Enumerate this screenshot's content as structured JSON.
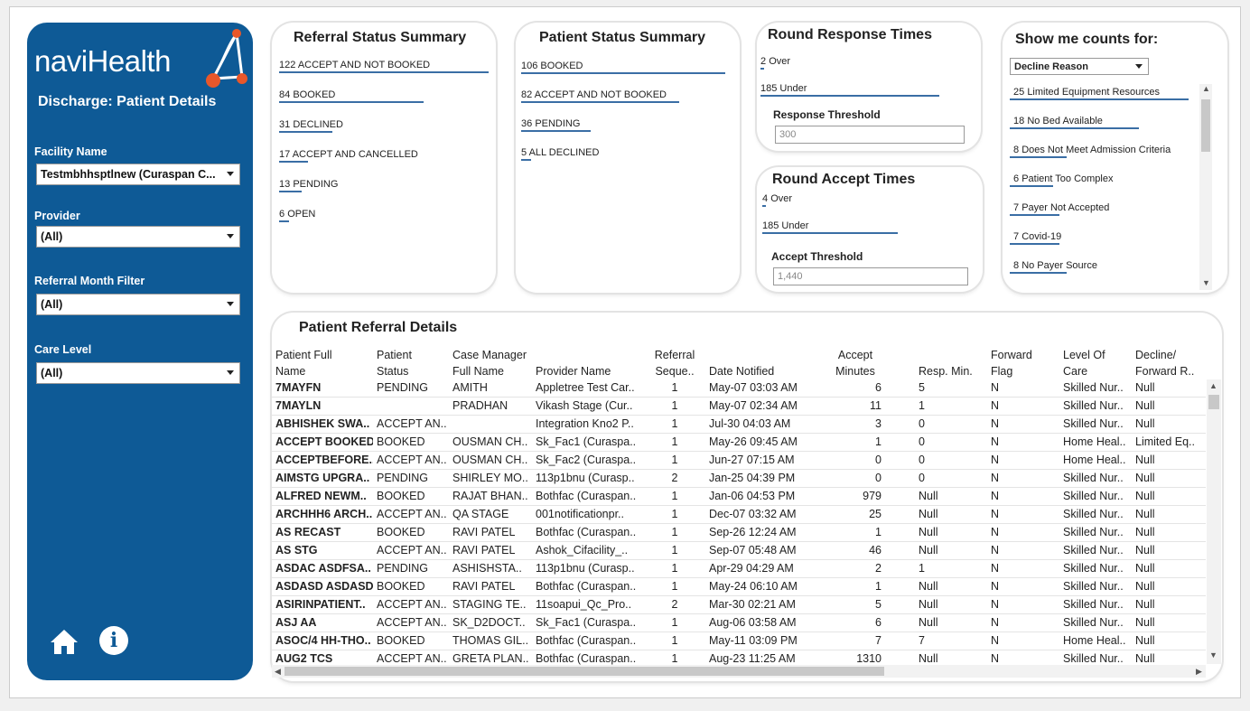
{
  "app": {
    "logo_text_bold": "navi",
    "logo_text": "Health",
    "page_title": "Discharge: Patient Details",
    "brand_color": "#0e5a96",
    "accent_color": "#e8572a"
  },
  "filters": {
    "facility": {
      "label": "Facility Name",
      "value": "Testmbhhsptlnew (Curaspan C..."
    },
    "provider": {
      "label": "Provider",
      "value": "(All)"
    },
    "referral_month": {
      "label": "Referral Month Filter",
      "value": "(All)"
    },
    "care_level": {
      "label": "Care Level",
      "value": "(All)"
    }
  },
  "referral_status": {
    "title": "Referral Status Summary",
    "items": [
      {
        "count": "122",
        "label": "ACCEPT AND NOT BOOKED",
        "value": 122
      },
      {
        "count": "84",
        "label": "BOOKED",
        "value": 84
      },
      {
        "count": "31",
        "label": "DECLINED",
        "value": 31
      },
      {
        "count": "17",
        "label": "ACCEPT AND CANCELLED",
        "value": 17
      },
      {
        "count": "13",
        "label": "PENDING",
        "value": 13
      },
      {
        "count": "6",
        "label": "OPEN",
        "value": 6
      }
    ]
  },
  "patient_status": {
    "title": "Patient Status Summary",
    "items": [
      {
        "count": "106",
        "label": "BOOKED",
        "value": 106
      },
      {
        "count": "82",
        "label": "ACCEPT AND NOT BOOKED",
        "value": 82
      },
      {
        "count": "36",
        "label": "PENDING",
        "value": 36
      },
      {
        "count": "5",
        "label": "ALL DECLINED",
        "value": 5
      }
    ]
  },
  "response_times": {
    "title": "Round Response Times",
    "items": [
      {
        "count": "2",
        "label": "Over",
        "value": 2
      },
      {
        "count": "185",
        "label": "Under",
        "value": 185
      }
    ],
    "threshold_label": "Response Threshold",
    "threshold_value": "300"
  },
  "accept_times": {
    "title": "Round Accept Times",
    "items": [
      {
        "count": "4",
        "label": "Over",
        "value": 4
      },
      {
        "count": "185",
        "label": "Under",
        "value": 185
      }
    ],
    "threshold_label": "Accept Threshold",
    "threshold_value": "1,440"
  },
  "counts": {
    "title": "Show me counts for:",
    "selector": "Decline Reason",
    "items": [
      {
        "count": "25",
        "label": "Limited Equipment Resources",
        "value": 25
      },
      {
        "count": "18",
        "label": "No Bed Available",
        "value": 18
      },
      {
        "count": "8",
        "label": "Does Not Meet Admission Criteria",
        "value": 8
      },
      {
        "count": "6",
        "label": "Patient Too Complex",
        "value": 6
      },
      {
        "count": "7",
        "label": "Payer Not Accepted",
        "value": 7
      },
      {
        "count": "7",
        "label": "Covid-19",
        "value": 7
      },
      {
        "count": "8",
        "label": "No Payer Source",
        "value": 8
      }
    ]
  },
  "details": {
    "title": "Patient Referral Details",
    "columns": [
      {
        "l1": "Patient Full",
        "l2": "Name"
      },
      {
        "l1": "Patient",
        "l2": "Status"
      },
      {
        "l1": "Case Manager",
        "l2": "Full Name"
      },
      {
        "l1": "",
        "l2": "Provider Name"
      },
      {
        "l1": "Referral",
        "l2": "Seque.."
      },
      {
        "l1": "",
        "l2": "Date Notified"
      },
      {
        "l1": "Accept",
        "l2": "Minutes"
      },
      {
        "l1": "",
        "l2": "Resp. Min."
      },
      {
        "l1": "Forward",
        "l2": "Flag"
      },
      {
        "l1": "Level Of",
        "l2": "Care"
      },
      {
        "l1": "Decline/",
        "l2": "Forward R.."
      }
    ],
    "rows": [
      [
        "7MAYFN",
        "PENDING",
        "AMITH",
        "Appletree Test Car..",
        "1",
        "May-07  03:03 AM",
        "6",
        "5",
        "N",
        "Skilled Nur..",
        "Null"
      ],
      [
        "7MAYLN",
        "",
        "PRADHAN",
        "Vikash Stage (Cur..",
        "1",
        "May-07  02:34 AM",
        "11",
        "1",
        "N",
        "Skilled Nur..",
        "Null"
      ],
      [
        "ABHISHEK SWA..",
        "ACCEPT AN..",
        "",
        "Integration Kno2 P..",
        "1",
        "Jul-30  04:03 AM",
        "3",
        "0",
        "N",
        "Skilled Nur..",
        "Null"
      ],
      [
        "ACCEPT BOOKED",
        "BOOKED",
        "OUSMAN CH..",
        "Sk_Fac1 (Curaspa..",
        "1",
        "May-26  09:45 AM",
        "1",
        "0",
        "N",
        "Home Heal..",
        "Limited Eq.."
      ],
      [
        "ACCEPTBEFORE..",
        "ACCEPT AN..",
        "OUSMAN CH..",
        "Sk_Fac2 (Curaspa..",
        "1",
        "Jun-27  07:15 AM",
        "0",
        "0",
        "N",
        "Home Heal..",
        "Null"
      ],
      [
        "AIMSTG UPGRA..",
        "PENDING",
        "SHIRLEY MO..",
        "113p1bnu (Curasp..",
        "2",
        "Jan-25  04:39 PM",
        "0",
        "0",
        "N",
        "Skilled Nur..",
        "Null"
      ],
      [
        "ALFRED NEWM..",
        "BOOKED",
        "RAJAT BHAN..",
        "Bothfac (Curaspan..",
        "1",
        "Jan-06  04:53 PM",
        "979",
        "Null",
        "N",
        "Skilled Nur..",
        "Null"
      ],
      [
        "ARCHHH6 ARCH..",
        "ACCEPT AN..",
        "QA STAGE",
        "001notificationpr..",
        "1",
        "Dec-07  03:32 AM",
        "25",
        "Null",
        "N",
        "Skilled Nur..",
        "Null"
      ],
      [
        "AS RECAST",
        "BOOKED",
        "RAVI PATEL",
        "Bothfac (Curaspan..",
        "1",
        "Sep-26  12:24 AM",
        "1",
        "Null",
        "N",
        "Skilled Nur..",
        "Null"
      ],
      [
        "AS STG",
        "ACCEPT AN..",
        "RAVI PATEL",
        "Ashok_Cifacility_..",
        "1",
        "Sep-07  05:48 AM",
        "46",
        "Null",
        "N",
        "Skilled Nur..",
        "Null"
      ],
      [
        "ASDAC ASDFSA..",
        "PENDING",
        "ASHISHSTA..",
        "113p1bnu (Curasp..",
        "1",
        "Apr-29  04:29 AM",
        "2",
        "1",
        "N",
        "Skilled Nur..",
        "Null"
      ],
      [
        "ASDASD ASDASD",
        "BOOKED",
        "RAVI PATEL",
        "Bothfac (Curaspan..",
        "1",
        "May-24  06:10 AM",
        "1",
        "Null",
        "N",
        "Skilled Nur..",
        "Null"
      ],
      [
        "ASIRINPATIENT..",
        "ACCEPT AN..",
        "STAGING TE..",
        "11soapui_Qc_Pro..",
        "2",
        "Mar-30  02:21 AM",
        "5",
        "Null",
        "N",
        "Skilled Nur..",
        "Null"
      ],
      [
        "ASJ AA",
        "ACCEPT AN..",
        "SK_D2DOCT..",
        "Sk_Fac1 (Curaspa..",
        "1",
        "Aug-06  03:58 AM",
        "6",
        "Null",
        "N",
        "Skilled Nur..",
        "Null"
      ],
      [
        "ASOC/4 HH-THO..",
        "BOOKED",
        "THOMAS GIL..",
        "Bothfac (Curaspan..",
        "1",
        "May-11  03:09 PM",
        "7",
        "7",
        "N",
        "Home Heal..",
        "Null"
      ],
      [
        "AUG2 TCS",
        "ACCEPT AN..",
        "GRETA PLAN..",
        "Bothfac (Curaspan..",
        "1",
        "Aug-23  11:25 AM",
        "1310",
        "Null",
        "N",
        "Skilled Nur..",
        "Null"
      ]
    ]
  },
  "icons": {
    "home": "home-icon",
    "info": "info-icon"
  }
}
